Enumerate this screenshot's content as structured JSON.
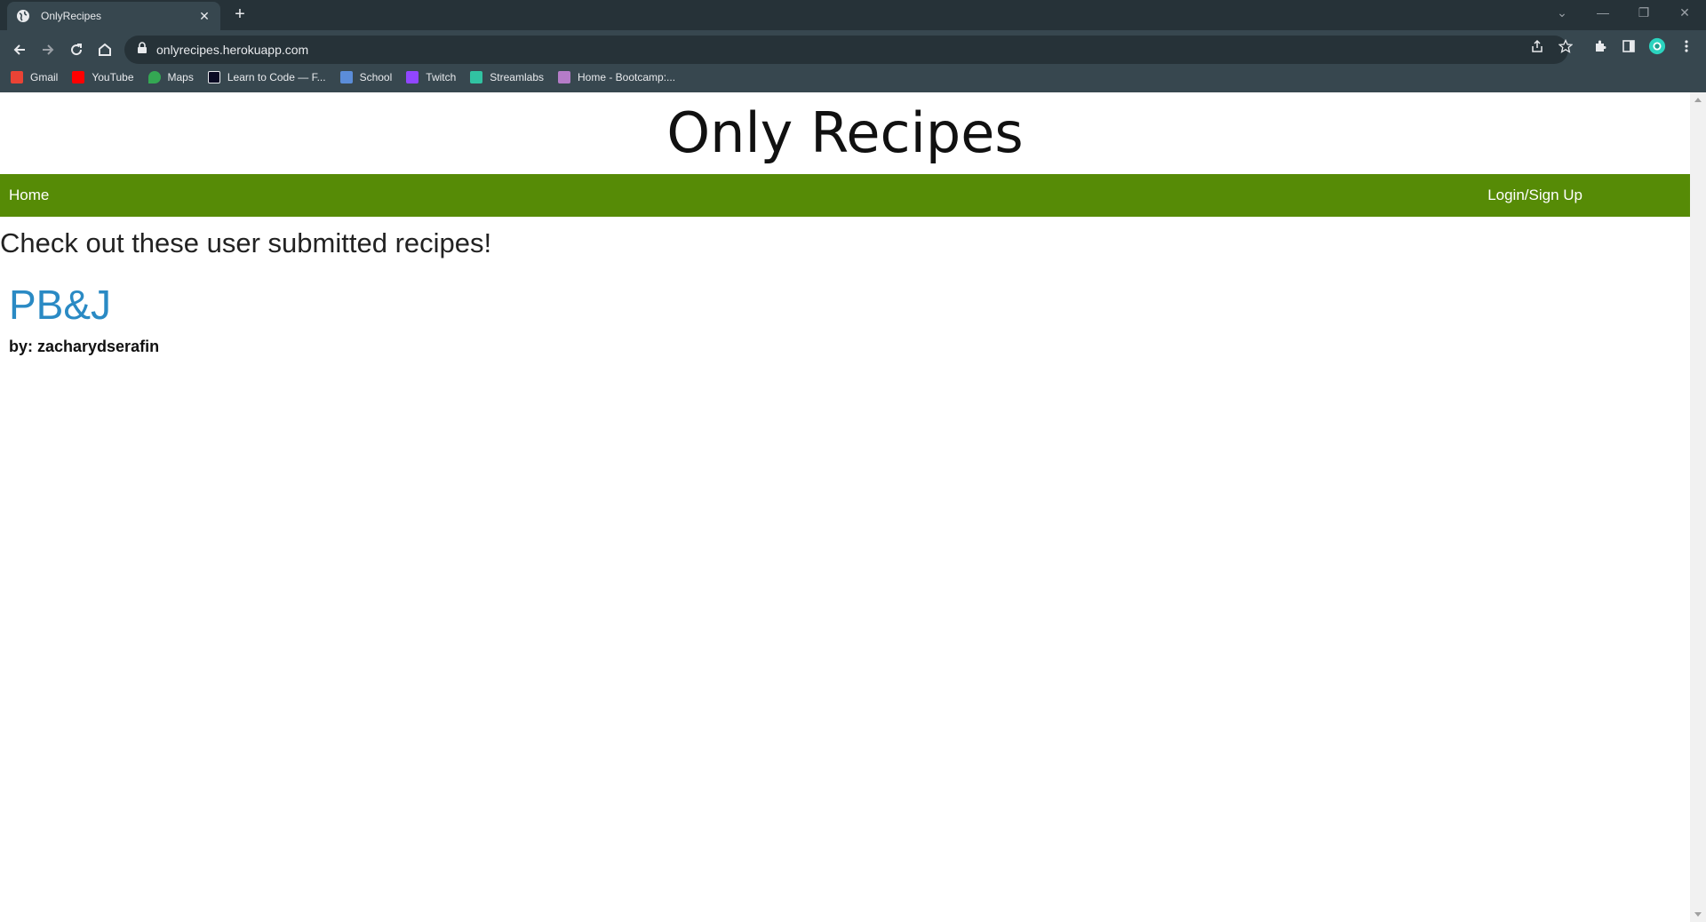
{
  "browser": {
    "tab": {
      "title": "OnlyRecipes",
      "close_icon": "close-icon"
    },
    "url": "onlyrecipes.herokuapp.com",
    "bookmarks": [
      {
        "label": "Gmail",
        "color": "#ea4335"
      },
      {
        "label": "YouTube",
        "color": "#ff0000"
      },
      {
        "label": "Maps",
        "color": "#34a853"
      },
      {
        "label": "Learn to Code — F...",
        "color": "#0a0a23"
      },
      {
        "label": "School",
        "color": "#5b8dd9"
      },
      {
        "label": "Twitch",
        "color": "#9146ff"
      },
      {
        "label": "Streamlabs",
        "color": "#31c3a2"
      },
      {
        "label": "Home - Bootcamp:...",
        "color": "#b57cc8"
      }
    ]
  },
  "site": {
    "title": "Only Recipes",
    "nav": {
      "home": "Home",
      "login": "Login/Sign Up"
    },
    "accent_color": "#568b06"
  },
  "main": {
    "intro": "Check out these user submitted recipes!",
    "recipes": [
      {
        "title": "PB&J",
        "author": "by: zacharydserafin"
      }
    ]
  }
}
